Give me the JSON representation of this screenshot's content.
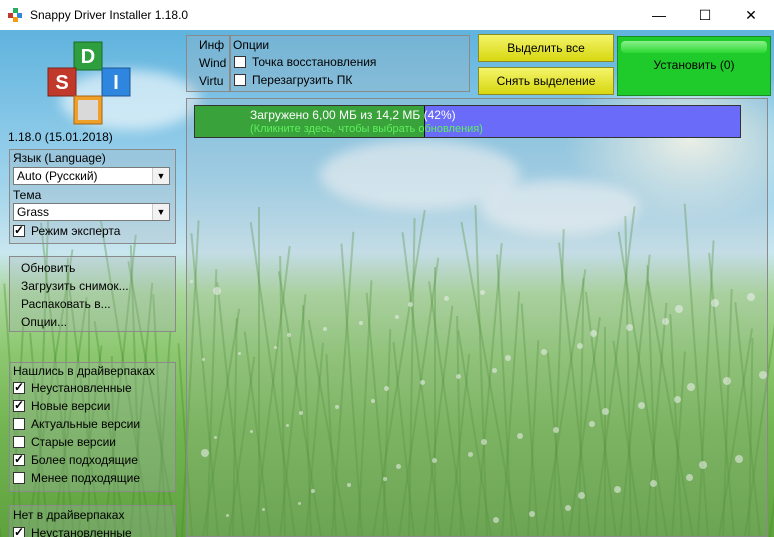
{
  "window": {
    "title": "Snappy Driver Installer 1.18.0",
    "minimize": "—",
    "maximize": "☐",
    "close": "✕"
  },
  "version": "1.18.0 (15.01.2018)",
  "settings": {
    "language_label": "Язык (Language)",
    "language_value": "Auto (Русский)",
    "theme_label": "Тема",
    "theme_value": "Grass",
    "expert_mode": "Режим эксперта",
    "expert_checked": true
  },
  "actions": [
    "Обновить",
    "Загрузить снимок...",
    "Распаковать в...",
    "Опции..."
  ],
  "found_group": {
    "title": "Нашлись в драйверпаках",
    "items": [
      {
        "label": "Неустановленные",
        "checked": true
      },
      {
        "label": "Новые версии",
        "checked": true
      },
      {
        "label": "Актуальные версии",
        "checked": false
      },
      {
        "label": "Старые версии",
        "checked": false
      },
      {
        "label": "Более подходящие",
        "checked": true
      },
      {
        "label": "Менее подходящие",
        "checked": false
      }
    ]
  },
  "missing_group": {
    "title": "Нет в драйверпаках",
    "items": [
      {
        "label": "Неустановленные",
        "checked": true
      }
    ]
  },
  "info": {
    "lines": [
      "Инф",
      "Wind",
      "Virtu"
    ]
  },
  "options": {
    "title": "Опции",
    "restore_point": "Точка восстановления",
    "reboot": "Перезагрузить ПК"
  },
  "buttons": {
    "select_all": "Выделить все",
    "deselect": "Снять выделение",
    "install": "Установить (0)"
  },
  "progress": {
    "text": "Загружено 6,00 МБ из 14,2 МБ (42%)",
    "hint": "(Кликните здесь, чтобы выбрать обновления)",
    "fraction": 0.42
  },
  "colors": {
    "install": "#1ecb2a",
    "yellow": "#e6e626",
    "progress_done": "#3aa23a",
    "progress_rest": "#6b6bfa"
  }
}
